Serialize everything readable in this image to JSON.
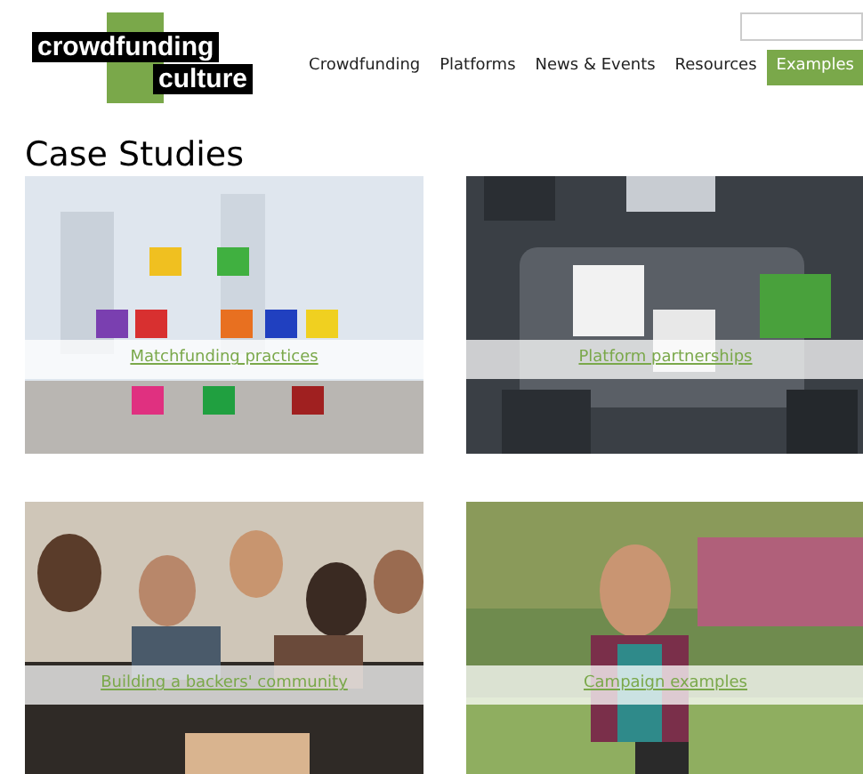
{
  "logo": {
    "line_1": "crowdfunding",
    "line_2": "culture"
  },
  "nav": [
    {
      "label": "Crowdfunding",
      "selected": false
    },
    {
      "label": "Platforms",
      "selected": false
    },
    {
      "label": "News & Events",
      "selected": false
    },
    {
      "label": "Resources",
      "selected": false
    },
    {
      "label": "Examples",
      "selected": true
    }
  ],
  "heading": "Case Studies",
  "cards": [
    {
      "caption": "Matchfunding practices",
      "kind": "puzzle"
    },
    {
      "caption": "Platform partnerships",
      "kind": "table"
    },
    {
      "caption": "Building a backers' community",
      "kind": "group"
    },
    {
      "caption": "Campaign examples",
      "kind": "portrait"
    }
  ]
}
